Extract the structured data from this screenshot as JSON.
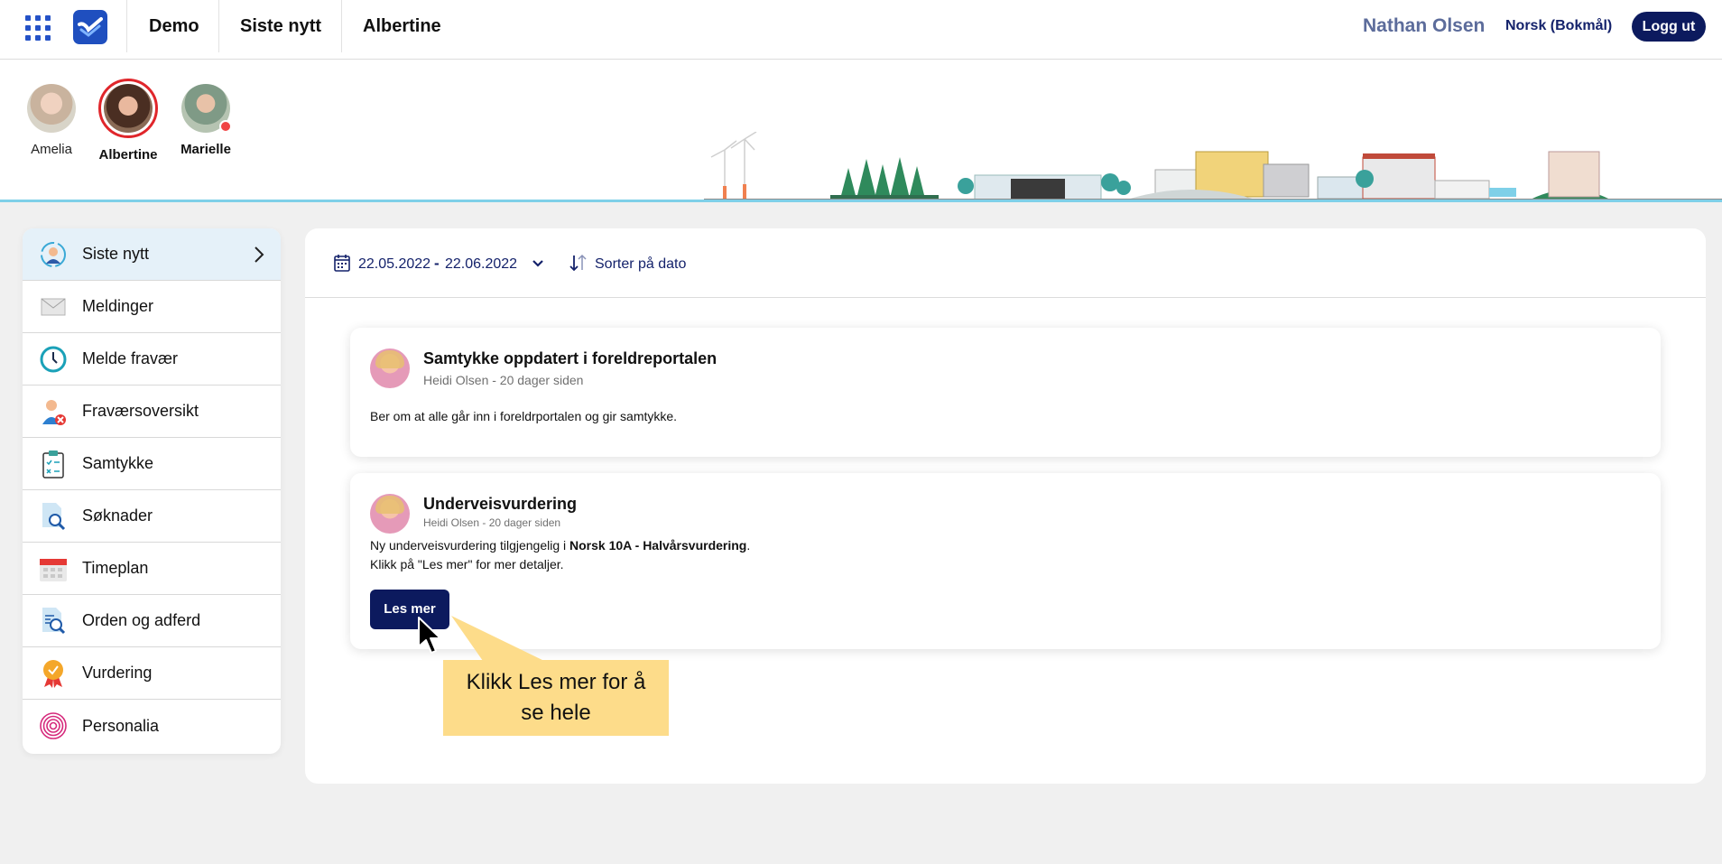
{
  "topbar": {
    "nav": [
      "Demo",
      "Siste nytt",
      "Albertine"
    ],
    "user_name": "Nathan Olsen",
    "language": "Norsk (Bokmål)",
    "logout_label": "Logg ut"
  },
  "children": [
    {
      "name": "Amelia",
      "selected": false
    },
    {
      "name": "Albertine",
      "selected": true
    },
    {
      "name": "Marielle",
      "selected": false,
      "has_notification": true
    }
  ],
  "sidebar": {
    "items": [
      {
        "label": "Siste nytt",
        "icon": "news-person-icon",
        "active": true
      },
      {
        "label": "Meldinger",
        "icon": "envelope-icon"
      },
      {
        "label": "Melde fravær",
        "icon": "clock-icon"
      },
      {
        "label": "Fraværsoversikt",
        "icon": "person-absent-icon"
      },
      {
        "label": "Samtykke",
        "icon": "clipboard-checklist-icon"
      },
      {
        "label": "Søknader",
        "icon": "document-search-icon"
      },
      {
        "label": "Timeplan",
        "icon": "calendar-icon"
      },
      {
        "label": "Orden og adferd",
        "icon": "document-magnify-icon"
      },
      {
        "label": "Vurdering",
        "icon": "award-badge-icon"
      },
      {
        "label": "Personalia",
        "icon": "fingerprint-icon"
      }
    ]
  },
  "filter": {
    "date_from": "22.05.2022",
    "date_separator": "-",
    "date_to": "22.06.2022",
    "sort_label": "Sorter på dato"
  },
  "posts": [
    {
      "title": "Samtykke oppdatert i foreldreportalen",
      "meta": "Heidi Olsen - 20 dager siden",
      "body": "Ber om at alle går inn i foreldrportalen og gir samtykke."
    },
    {
      "title": "Underveisvurdering",
      "meta": "Heidi Olsen - 20 dager siden",
      "body_prefix": "Ny underveisvurdering tilgjengelig i ",
      "body_bold": "Norsk 10A - Halvårsvurdering",
      "body_suffix": ".",
      "body_line2": "Klikk på \"Les mer\" for mer detaljer.",
      "button_label": "Les mer"
    }
  ],
  "callout": {
    "line1": "Klikk Les mer for å",
    "line2": "se hele"
  },
  "colors": {
    "primary": "#0c1a5e",
    "accent_blue": "#1f4fbf",
    "selected_ring": "#e0262b",
    "callout_bg": "#fddc8a",
    "active_item_bg": "#e5f1f9"
  }
}
